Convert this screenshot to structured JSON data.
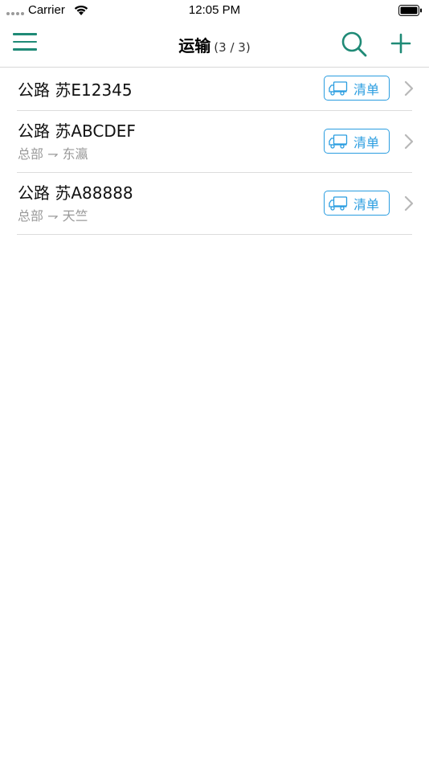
{
  "status_bar": {
    "carrier": "Carrier",
    "time": "12:05 PM"
  },
  "nav": {
    "title": "运输",
    "count": "(3 / 3)",
    "accent_color": "#1f8a76"
  },
  "list_button_color": "#2a9de0",
  "items": [
    {
      "title": "公路 苏E12345",
      "subtitle": "",
      "button_label": "清单"
    },
    {
      "title": "公路 苏ABCDEF",
      "subtitle": "总部 ⇁ 东瀛",
      "button_label": "清单"
    },
    {
      "title": "公路 苏A88888",
      "subtitle": "总部 ⇁ 天竺",
      "button_label": "清单"
    }
  ],
  "icons": {
    "menu": "hamburger-menu-icon",
    "search": "search-icon",
    "add": "plus-icon",
    "list_button": "truck-icon",
    "row_arrow": "chevron-right-icon"
  }
}
